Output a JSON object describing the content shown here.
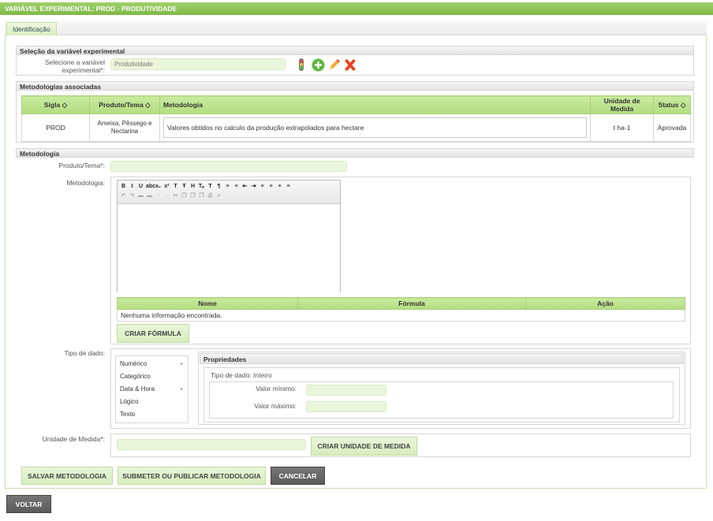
{
  "window_title": "VARIÁVEL EXPERIMENTAL: PROD - PRODUTIVIDADE",
  "tab_label": "Identificação",
  "selecao": {
    "header": "Seleção da variável experimental",
    "label": "Selecione a variável experimental",
    "required_mark": "*:",
    "value": "Produtividade"
  },
  "metodologias_assoc": {
    "header": "Metodologias associadas",
    "columns": [
      "Sigla ◇",
      "Produto/Tema ◇",
      "Metodologia",
      "Unidade de Medida",
      "Status ◇"
    ],
    "row": {
      "sigla": "PROD",
      "produto": "Ameixa, Pêssego e Nectarina",
      "metodologia": "Valores obtidos no calculo da produção extrapolados para hectare",
      "unidade": "t ha-1",
      "status": "Aprovada"
    }
  },
  "metodologia": {
    "header": "Metodologia",
    "produto_label": "Produto/Tema",
    "produto_req": "*:",
    "metodologia_label": "Metodologia:",
    "formula_columns": [
      "Nome",
      "Fórmula",
      "Ação"
    ],
    "formula_empty": "Nenhuma informação encontrada.",
    "criar_formula": "CRIAR FÓRMULA",
    "tipo_label": "Tipo de dado:",
    "tipos": [
      "Numérico",
      "Categórico",
      "Data & Hora",
      "Lógico",
      "Texto"
    ],
    "arrow": "▸",
    "propriedades_header": "Propriedades",
    "tipo_info_label": "Tipo de dado:",
    "tipo_info_value": "Inteiro",
    "valor_minimo": "Valor mínimo:",
    "valor_maximo": "Valor máximo:",
    "unidade_label": "Unidade de Medida",
    "unidade_req": "*:",
    "criar_unidade": "CRIAR UNIDADE DE MEDIDA"
  },
  "actions": {
    "salvar": "SALVAR METODOLOGIA",
    "submeter": "SUBMETER OU PUBLICAR METODOLOGIA",
    "cancelar": "CANCELAR"
  },
  "voltar": "VOLTAR",
  "colors": {
    "accent": "#8cc152",
    "field_bg": "#eaf6dc",
    "delete": "#e8421b"
  },
  "editor_toolbar": {
    "row1": [
      "B",
      "I",
      "U",
      "abc",
      "x₂",
      "x²",
      "T",
      "Ŧ",
      "H",
      "Tₚ",
      "T",
      "¶",
      "≡",
      "≡",
      "⇤",
      "⇥",
      "≡",
      "≡",
      "≡",
      "≡"
    ],
    "row2": [
      "↶",
      "↷",
      "▬",
      "▬",
      "◔",
      "◌",
      "✂",
      "❐",
      "❐",
      "❐",
      "⎙",
      "⌕"
    ]
  }
}
